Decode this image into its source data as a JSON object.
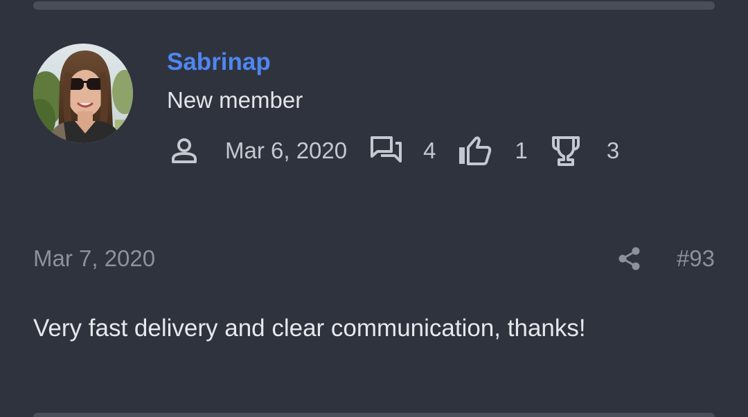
{
  "user": {
    "name": "Sabrinap",
    "title": "New member",
    "avatar_icon": "avatar-photo"
  },
  "stats": {
    "joined": "Mar 6, 2020",
    "messages": "4",
    "reactions": "1",
    "points": "3",
    "icons": [
      "person-icon",
      "messages-icon",
      "thumbs-up-icon",
      "trophy-icon"
    ]
  },
  "post": {
    "date": "Mar 7, 2020",
    "number": "#93",
    "body": "Very fast delivery and clear communication, thanks!",
    "share_icon": "share-icon"
  },
  "colors": {
    "background": "#2f333e",
    "username": "#4f86f0",
    "muted": "#8d919b",
    "text": "#e6e8ee"
  }
}
